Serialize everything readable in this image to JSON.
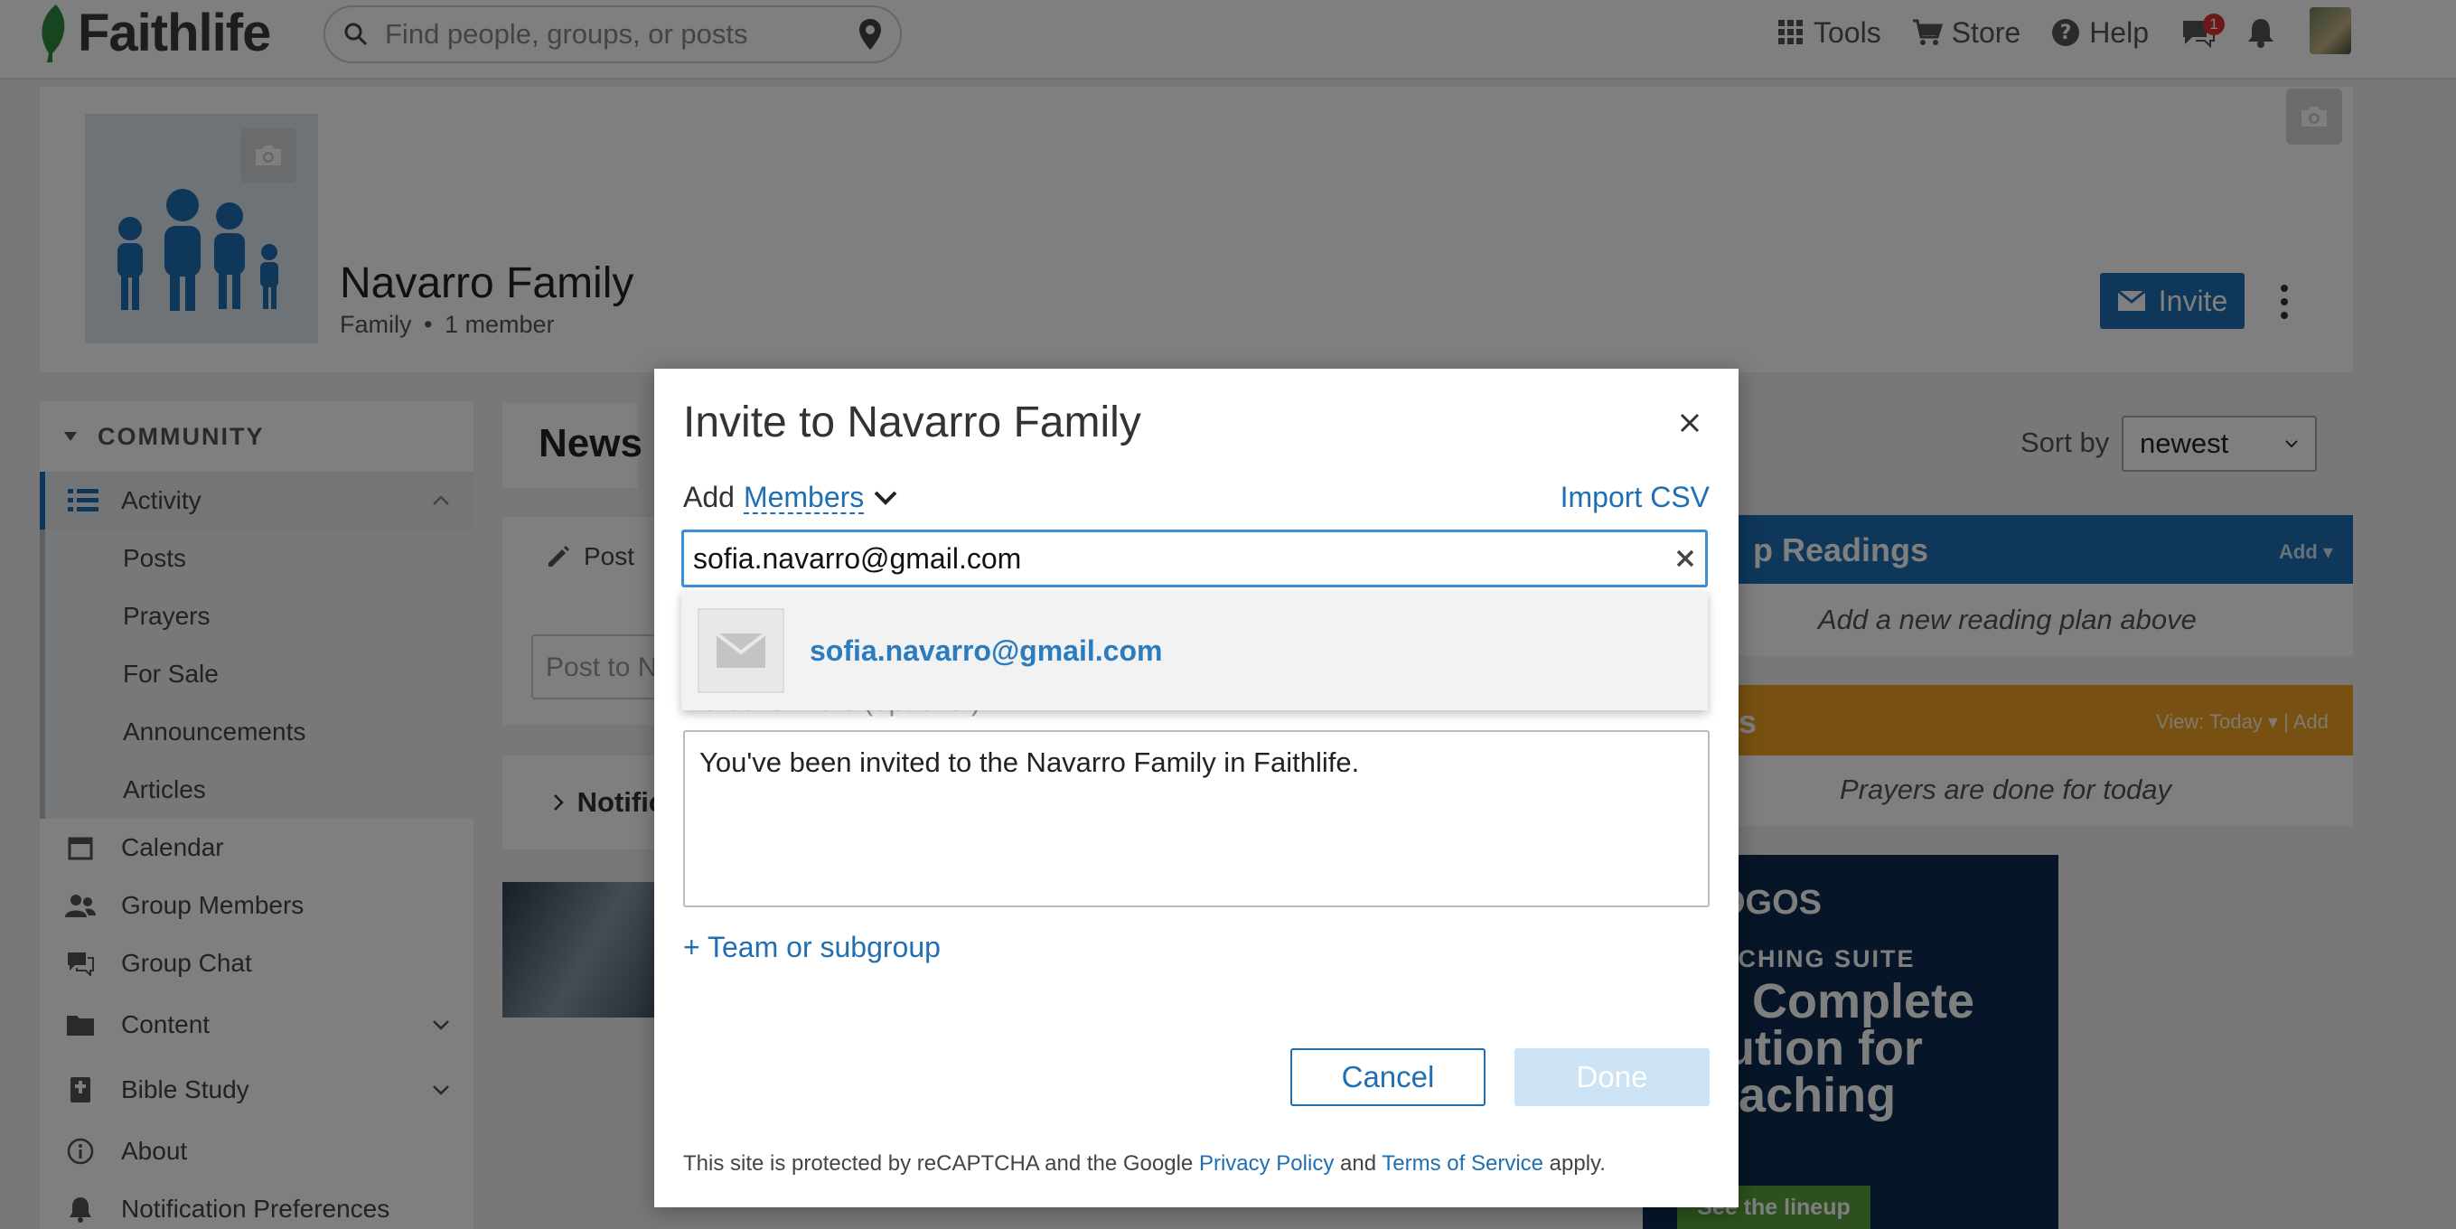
{
  "header": {
    "brand": "Faithlife",
    "search_placeholder": "Find people, groups, or posts",
    "nav": {
      "tools": "Tools",
      "store": "Store",
      "help": "Help"
    },
    "messages_badge": "1"
  },
  "group": {
    "name": "Navarro Family",
    "type": "Family",
    "separator": "•",
    "members": "1 member",
    "invite_label": "Invite"
  },
  "sidebar": {
    "section": "COMMUNITY",
    "activity": "Activity",
    "sub_items": [
      "Posts",
      "Prayers",
      "For Sale",
      "Announcements",
      "Articles"
    ],
    "items": [
      "Calendar",
      "Group Members",
      "Group Chat",
      "Content",
      "Bible Study",
      "About",
      "Notification Preferences"
    ]
  },
  "feed": {
    "title": "News",
    "post_tab": "Post",
    "post_placeholder": "Post to N",
    "notifications": "Notific"
  },
  "right": {
    "sort_label": "Sort by",
    "sort_value": "newest",
    "readings_title": "p Readings",
    "readings_add": "Add ▾",
    "readings_empty": "Add a new reading plan above",
    "prayers_title": "ers",
    "prayers_view": "View: Today ▾ | Add",
    "prayers_empty": "Prayers are done for today",
    "ad_brand": "OGOS",
    "ad_suite": "ACHING SUITE",
    "ad_headline": "e Complete lution for eaching",
    "ad_cta": "See the lineup"
  },
  "modal": {
    "title": "Invite to Navarro Family",
    "add_prefix": "Add",
    "add_type": "Members",
    "import_csv": "Import CSV",
    "input_value": "sofia.navarro@gmail.com",
    "suggestion": "sofia.navarro@gmail.com",
    "note_label": "Personal note (optional):",
    "note_value": "You've been invited to the Navarro Family in Faithlife.",
    "subgroup_link": "+ Team or subgroup",
    "cancel": "Cancel",
    "done": "Done",
    "footer_prefix": "This site is protected by reCAPTCHA and the Google",
    "privacy_link": "Privacy Policy",
    "footer_and": "and",
    "terms_link": "Terms of Service",
    "footer_suffix": "apply."
  },
  "colors": {
    "brand_blue": "#1f6fb2",
    "prayers_orange": "#f0a224",
    "logo_green": "#2e8b3e"
  },
  "icons": [
    "leaf-icon",
    "search-icon",
    "location-pin-icon",
    "grid-icon",
    "cart-icon",
    "help-icon",
    "chat-icon",
    "bell-icon",
    "camera-icon",
    "mail-icon",
    "close-icon",
    "chevron-down-icon",
    "pencil-icon",
    "envelope-icon"
  ]
}
